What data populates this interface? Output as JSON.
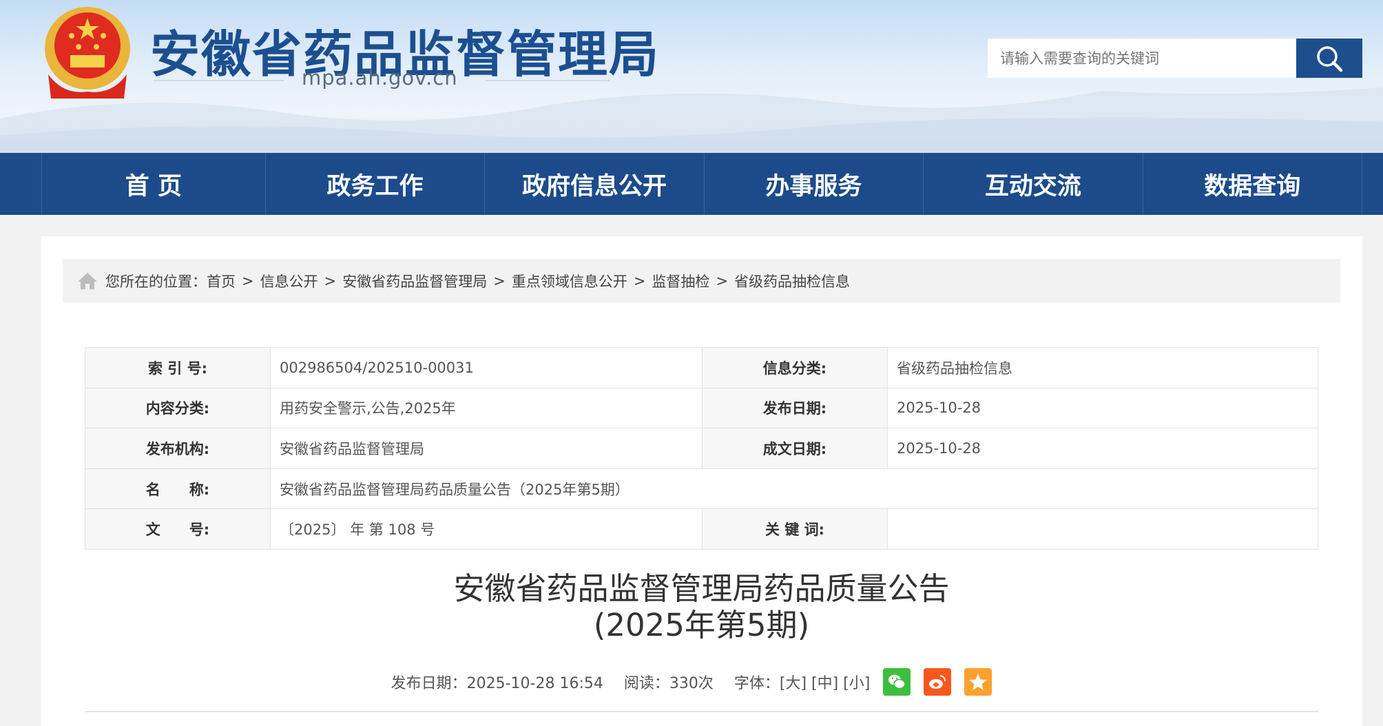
{
  "header": {
    "title": "安徽省药品监督管理局",
    "domain": "mpa.ah.gov.cn",
    "search_placeholder": "请输入需要查询的关键词"
  },
  "nav": [
    "首 页",
    "政务工作",
    "政府信息公开",
    "办事服务",
    "互动交流",
    "数据查询"
  ],
  "breadcrumb": {
    "prefix": "您所在的位置：",
    "items": [
      "首页",
      "信息公开",
      "安徽省药品监督管理局",
      "重点领域信息公开",
      "监督抽检",
      "省级药品抽检信息"
    ],
    "sep": ">"
  },
  "meta": {
    "index_label": "索 引 号:",
    "index": "002986504/202510-00031",
    "category_label": "信息分类:",
    "category": "省级药品抽检信息",
    "content_label": "内容分类:",
    "content": "用药安全警示,公告,2025年",
    "pubdate_label": "发布日期:",
    "pubdate": "2025-10-28",
    "org_label": "发布机构:",
    "org": "安徽省药品监督管理局",
    "written_label": "成文日期:",
    "written": "2025-10-28",
    "name_label": "名　　称:",
    "name": "安徽省药品监督管理局药品质量公告（2025年第5期）",
    "docno_label": "文　　号:",
    "docno": "〔2025〕 年 第 108 号",
    "keywords_label": "关 键 词:",
    "keywords": ""
  },
  "article": {
    "title_line1": "安徽省药品监督管理局药品质量公告",
    "title_line2": "(2025年第5期)",
    "date": "发布日期：2025-10-28 16:54",
    "reads": "阅读：330次",
    "font_label": "字体：",
    "font_large": "[大]",
    "font_mid": "[中]",
    "font_small": "[小]"
  },
  "colors": {
    "nav": "#1d4b8a",
    "wechat": "#3cbf3f",
    "weibo": "#f4581e",
    "qzone": "#ffa02e"
  }
}
